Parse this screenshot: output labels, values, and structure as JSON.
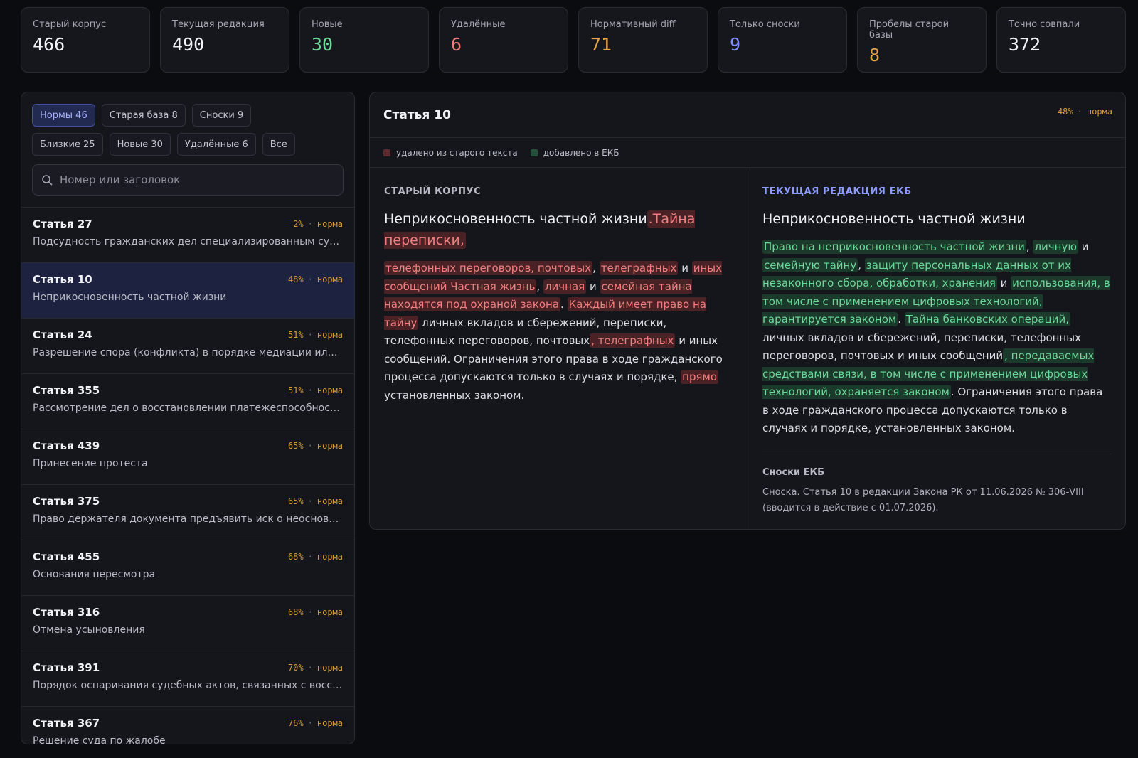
{
  "colors": {
    "white": "#f1f2f5",
    "green": "#6dd99a",
    "red": "#f07b7b",
    "orange": "#e3a34a",
    "blue": "#7f8cff",
    "deleted_bg": "#4a2226",
    "added_bg": "#1c3a2b"
  },
  "stats": [
    {
      "label": "Старый корпус",
      "value": "466",
      "color": "#f1f2f5"
    },
    {
      "label": "Текущая редакция",
      "value": "490",
      "color": "#f1f2f5"
    },
    {
      "label": "Новые",
      "value": "30",
      "color": "#6dd99a"
    },
    {
      "label": "Удалённые",
      "value": "6",
      "color": "#f07b7b"
    },
    {
      "label": "Нормативный diff",
      "value": "71",
      "color": "#e3a34a"
    },
    {
      "label": "Только сноски",
      "value": "9",
      "color": "#7f8cff"
    },
    {
      "label": "Пробелы старой базы",
      "value": "8",
      "color": "#e3a34a"
    },
    {
      "label": "Точно совпали",
      "value": "372",
      "color": "#f1f2f5"
    }
  ],
  "filters": [
    {
      "label": "Нормы 46",
      "active": true
    },
    {
      "label": "Старая база 8",
      "active": false
    },
    {
      "label": "Сноски 9",
      "active": false
    },
    {
      "label": "Близкие 25",
      "active": false
    },
    {
      "label": "Новые 30",
      "active": false
    },
    {
      "label": "Удалённые 6",
      "active": false
    },
    {
      "label": "Все",
      "active": false
    }
  ],
  "search": {
    "placeholder": "Номер или заголовок",
    "icon": "search-icon"
  },
  "list": [
    {
      "title": "Статья 27",
      "pct": "2%",
      "kind": "норма",
      "subtitle": "Подсудность гражданских дел специализированным суда…",
      "selected": false
    },
    {
      "title": "Статья 10",
      "pct": "48%",
      "kind": "норма",
      "subtitle": "Неприкосновенность частной жизни",
      "selected": true
    },
    {
      "title": "Статья 24",
      "pct": "51%",
      "kind": "норма",
      "subtitle": "Разрешение спора (конфликта) в порядке медиации или п…",
      "selected": false
    },
    {
      "title": "Статья 355",
      "pct": "51%",
      "kind": "норма",
      "subtitle": "Рассмотрение дел о восстановлении платежеспособности …",
      "selected": false
    },
    {
      "title": "Статья 439",
      "pct": "65%",
      "kind": "норма",
      "subtitle": "Принесение протеста",
      "selected": false
    },
    {
      "title": "Статья 375",
      "pct": "65%",
      "kind": "норма",
      "subtitle": "Право держателя документа предъявить иск о неосновате…",
      "selected": false
    },
    {
      "title": "Статья 455",
      "pct": "68%",
      "kind": "норма",
      "subtitle": "Основания пересмотра",
      "selected": false
    },
    {
      "title": "Статья 316",
      "pct": "68%",
      "kind": "норма",
      "subtitle": "Отмена усыновления",
      "selected": false
    },
    {
      "title": "Статья 391",
      "pct": "70%",
      "kind": "норма",
      "subtitle": "Порядок оспаривания судебных актов, связанных с восста…",
      "selected": false
    },
    {
      "title": "Статья 367",
      "pct": "76%",
      "kind": "норма",
      "subtitle": "Решение суда по жалобе",
      "selected": false
    }
  ],
  "detail": {
    "title": "Статья 10",
    "pct": "48%",
    "kind": "норма",
    "legend_deleted": "удалено из старого текста",
    "legend_added": "добавлено в ЕКБ",
    "old": {
      "label": "СТАРЫЙ КОРПУС",
      "heading": [
        {
          "t": "Неприкосновенность частной жизни",
          "s": ""
        },
        {
          "t": ".Тайна переписки,",
          "s": "del"
        }
      ],
      "text": [
        {
          "t": "телефонных переговоров, почтовых",
          "s": "del"
        },
        {
          "t": ", ",
          "s": ""
        },
        {
          "t": "телеграфных",
          "s": "del"
        },
        {
          "t": " и ",
          "s": ""
        },
        {
          "t": "иных сообщений Частная жизнь",
          "s": "del"
        },
        {
          "t": ", ",
          "s": ""
        },
        {
          "t": "личная",
          "s": "del"
        },
        {
          "t": " и ",
          "s": ""
        },
        {
          "t": "семейная тайна находятся под охраной закона",
          "s": "del"
        },
        {
          "t": ". ",
          "s": ""
        },
        {
          "t": "Каждый имеет право на тайну",
          "s": "del"
        },
        {
          "t": " личных вкладов и сбережений, переписки, телефонных переговоров, почтовых",
          "s": ""
        },
        {
          "t": ", телеграфных",
          "s": "del"
        },
        {
          "t": " и иных сообщений. Ограничения этого права в ходе гражданского процесса допускаются только в случаях и порядке, ",
          "s": ""
        },
        {
          "t": "прямо",
          "s": "del"
        },
        {
          "t": " установленных законом.",
          "s": ""
        }
      ]
    },
    "new": {
      "label": "ТЕКУЩАЯ РЕДАКЦИЯ ЕКБ",
      "heading": [
        {
          "t": "Неприкосновенность частной жизни",
          "s": ""
        }
      ],
      "text": [
        {
          "t": "Право на неприкосновенность частной жизни",
          "s": "add"
        },
        {
          "t": ", ",
          "s": ""
        },
        {
          "t": "личную",
          "s": "add"
        },
        {
          "t": " и ",
          "s": ""
        },
        {
          "t": "семейную тайну",
          "s": "add"
        },
        {
          "t": ", ",
          "s": ""
        },
        {
          "t": "защиту персональных данных от их незаконного сбора, обработки, хранения",
          "s": "add"
        },
        {
          "t": " и ",
          "s": ""
        },
        {
          "t": "использования, в том числе с применением цифровых технологий, гарантируется законом",
          "s": "add"
        },
        {
          "t": ". ",
          "s": ""
        },
        {
          "t": "Тайна банковских операций,",
          "s": "add"
        },
        {
          "t": " личных вкладов и сбережений, переписки, телефонных переговоров, почтовых и иных сообщений",
          "s": ""
        },
        {
          "t": ", передаваемых средствами связи, в том числе с применением цифровых технологий, охраняется законом",
          "s": "add"
        },
        {
          "t": ". Ограничения этого права в ходе гражданского процесса допускаются только в случаях и порядке, установленных законом.",
          "s": ""
        }
      ],
      "footnote_title": "Сноски ЕКБ",
      "footnote_text": "Сноска. Статья 10 в редакции Закона РК от 11.06.2026 № 306-VIII (вводится в действие с 01.07.2026)."
    }
  }
}
